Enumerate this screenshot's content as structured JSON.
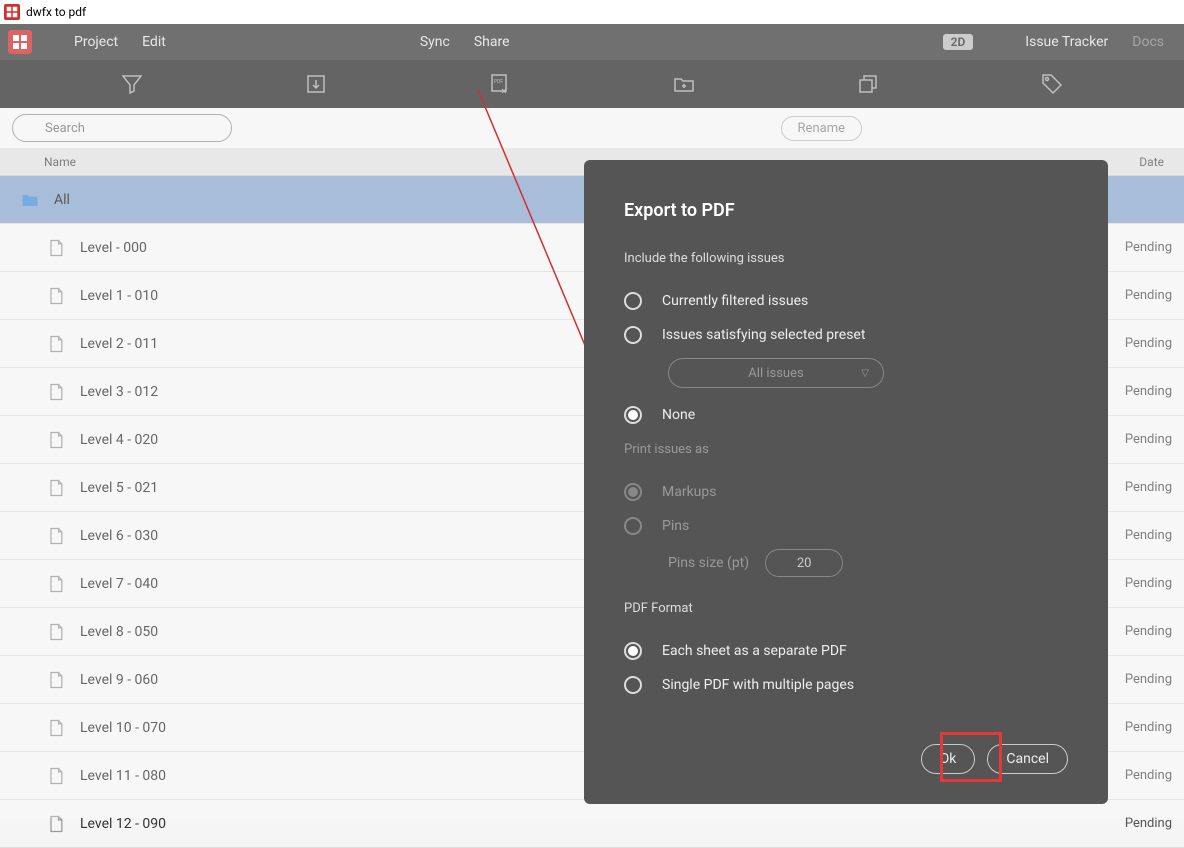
{
  "window": {
    "title": "dwfx to pdf"
  },
  "menu": {
    "project": "Project",
    "edit": "Edit",
    "sync": "Sync",
    "share": "Share",
    "mode2d": "2D",
    "issue_tracker": "Issue Tracker",
    "docs": "Docs"
  },
  "search": {
    "placeholder": "Search",
    "rename": "Rename"
  },
  "columns": {
    "name": "Name",
    "date": "Date"
  },
  "rows": [
    {
      "name": "All",
      "status": "",
      "folder": true,
      "selected": true
    },
    {
      "name": "Level - 000",
      "status": "Pending"
    },
    {
      "name": "Level 1 - 010",
      "status": "Pending"
    },
    {
      "name": "Level 2 - 011",
      "status": "Pending"
    },
    {
      "name": "Level 3 - 012",
      "status": "Pending"
    },
    {
      "name": "Level 4 - 020",
      "status": "Pending"
    },
    {
      "name": "Level 5 - 021",
      "status": "Pending"
    },
    {
      "name": "Level 6 - 030",
      "status": "Pending"
    },
    {
      "name": "Level 7 - 040",
      "status": "Pending"
    },
    {
      "name": "Level 8 - 050",
      "status": "Pending"
    },
    {
      "name": "Level 9 - 060",
      "status": "Pending"
    },
    {
      "name": "Level 10 - 070",
      "status": "Pending"
    },
    {
      "name": "Level 11 - 080",
      "status": "Pending"
    },
    {
      "name": "Level 12 - 090",
      "status": "Pending"
    }
  ],
  "dialog": {
    "title": "Export to PDF",
    "include_label": "Include the following issues",
    "opt_filtered": "Currently filtered issues",
    "opt_preset": "Issues satisfying selected preset",
    "preset_value": "All issues",
    "opt_none": "None",
    "print_label": "Print issues as",
    "opt_markups": "Markups",
    "opt_pins": "Pins",
    "pins_size_label": "Pins size (pt)",
    "pins_size_value": "20",
    "format_label": "PDF Format",
    "opt_separate": "Each sheet as a separate PDF",
    "opt_single": "Single PDF with multiple pages",
    "ok": "Ok",
    "cancel": "Cancel"
  }
}
